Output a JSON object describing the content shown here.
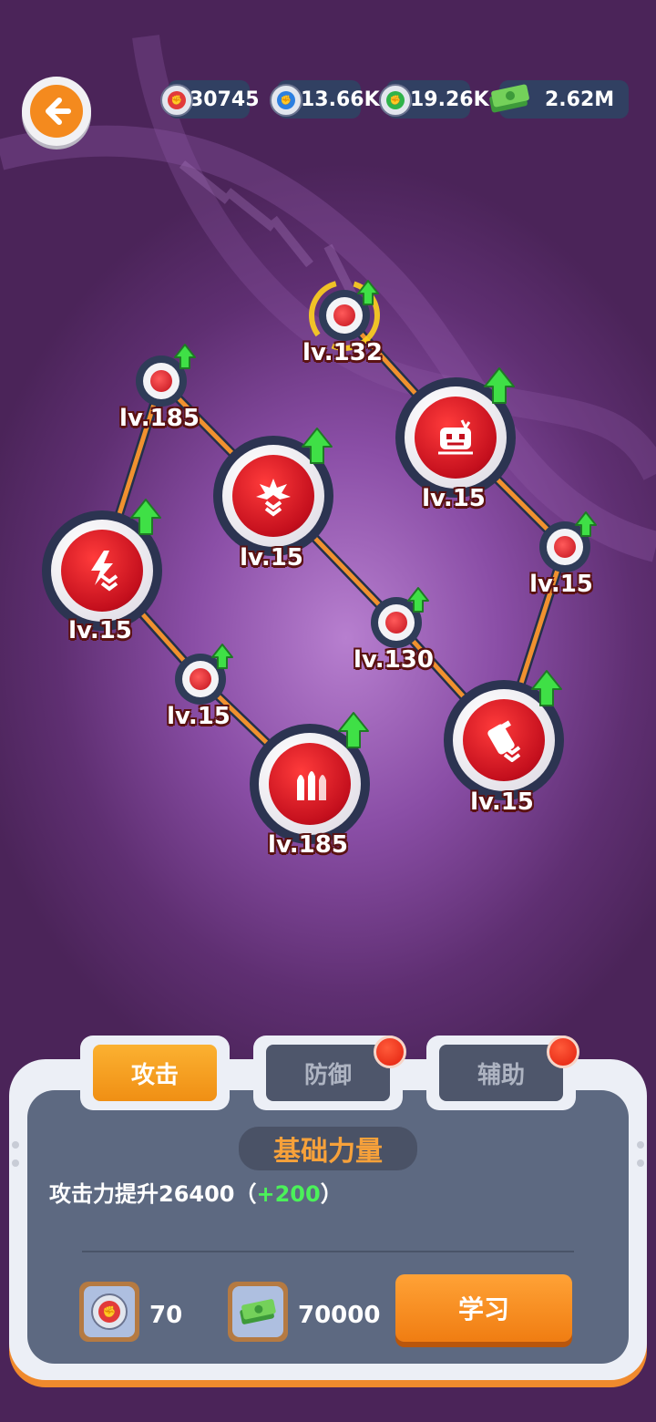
{
  "header": {
    "back_icon": "arrow-left-icon",
    "resources": [
      {
        "name": "red-fist-token",
        "value": "30745",
        "color": "#e23a3a"
      },
      {
        "name": "blue-fist-token",
        "value": "13.66K",
        "color": "#2c7fe0"
      },
      {
        "name": "green-fist-token",
        "value": "19.26K",
        "color": "#2fb34a"
      },
      {
        "name": "cash",
        "value": "2.62M",
        "color": "#56b94a"
      }
    ]
  },
  "tree": {
    "nodes": [
      {
        "level": "lv.132",
        "type": "small",
        "selected": true
      },
      {
        "level": "lv.185",
        "type": "small"
      },
      {
        "level": "lv.15",
        "type": "big",
        "icon": "explosion-chevrons-icon"
      },
      {
        "level": "lv.15",
        "type": "big",
        "icon": "robot-head-icon"
      },
      {
        "level": "lv.15",
        "type": "small"
      },
      {
        "level": "lv.15",
        "type": "big",
        "icon": "bolt-chevrons-icon"
      },
      {
        "level": "lv.130",
        "type": "small"
      },
      {
        "level": "lv.15",
        "type": "small"
      },
      {
        "level": "lv.185",
        "type": "big",
        "icon": "bullets-icon"
      },
      {
        "level": "lv.15",
        "type": "big",
        "icon": "canister-chevrons-icon"
      }
    ],
    "upgrade_arrow_color": "#3fe046"
  },
  "panel": {
    "tabs": [
      {
        "label": "攻击",
        "active": true,
        "badge": false
      },
      {
        "label": "防御",
        "active": false,
        "badge": true
      },
      {
        "label": "辅助",
        "active": false,
        "badge": true
      }
    ],
    "skill_title": "基础力量",
    "desc_main": "攻击力提升26400（",
    "desc_bonus": "+200",
    "desc_end": "）",
    "cost": [
      {
        "icon": "red-fist-token-icon",
        "value": "70"
      },
      {
        "icon": "cash-icon",
        "value": "70000"
      }
    ],
    "learn_label": "学习"
  }
}
